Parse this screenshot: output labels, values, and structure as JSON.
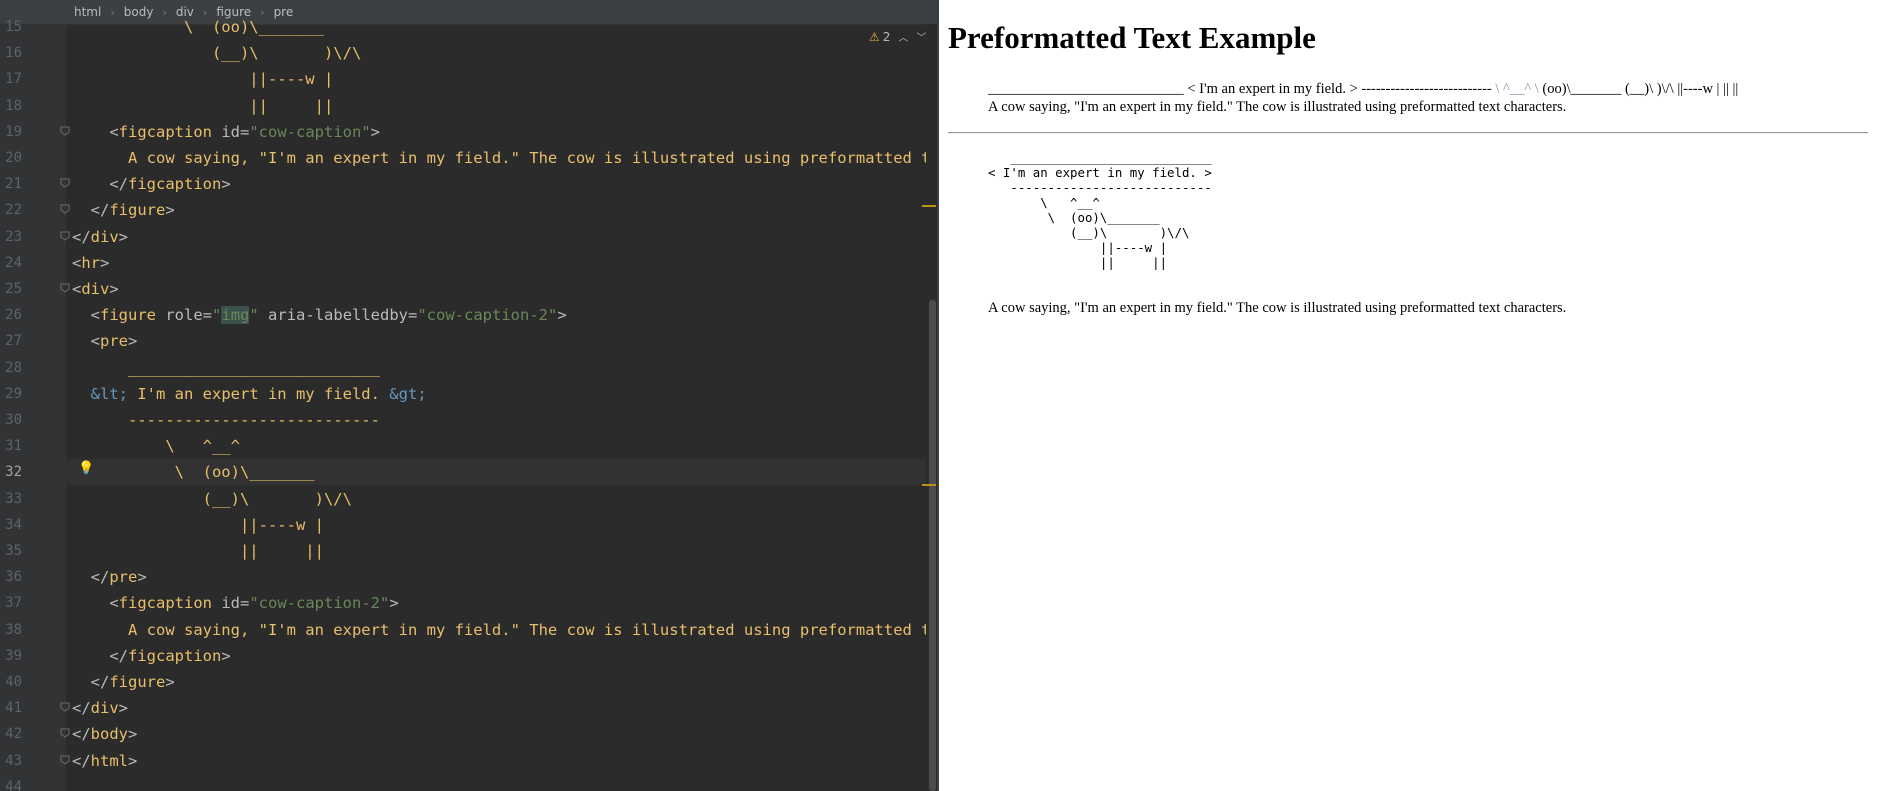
{
  "breadcrumb": [
    "html",
    "body",
    "div",
    "figure",
    "pre"
  ],
  "warnings": {
    "count": "2"
  },
  "colors": {
    "tag": "#e8bf6a",
    "attr_value": "#6a8759",
    "entity": "#6897bb",
    "text": "#a9b7c6",
    "warning": "#e6b34b"
  },
  "code_lines": [
    {
      "n": "15",
      "tokens": [
        [
          "t",
          "            \\  (oo)\\_______"
        ]
      ]
    },
    {
      "n": "16",
      "tokens": [
        [
          "t",
          "               (__)\\       )\\/\\"
        ]
      ]
    },
    {
      "n": "17",
      "tokens": [
        [
          "t",
          "                   ||----w |"
        ]
      ]
    },
    {
      "n": "18",
      "tokens": [
        [
          "t",
          "                   ||     ||"
        ]
      ]
    },
    {
      "n": "19",
      "tokens": [
        [
          "t",
          "    "
        ],
        [
          "p",
          "<"
        ],
        [
          "b",
          "figcaption"
        ],
        [
          "a",
          " id="
        ],
        [
          "s",
          "\"cow-caption\""
        ],
        [
          "p",
          ">"
        ]
      ]
    },
    {
      "n": "20",
      "tokens": [
        [
          "t",
          "      A cow saying, \"I'm an expert in my field.\" The cow is illustrated using preformatted text c"
        ]
      ]
    },
    {
      "n": "21",
      "tokens": [
        [
          "t",
          "    "
        ],
        [
          "p",
          "</"
        ],
        [
          "b",
          "figcaption"
        ],
        [
          "p",
          ">"
        ]
      ]
    },
    {
      "n": "22",
      "tokens": [
        [
          "t",
          "  "
        ],
        [
          "p",
          "</"
        ],
        [
          "b",
          "figure"
        ],
        [
          "p",
          ">"
        ]
      ]
    },
    {
      "n": "23",
      "tokens": [
        [
          "p",
          "</"
        ],
        [
          "b",
          "div"
        ],
        [
          "p",
          ">"
        ]
      ]
    },
    {
      "n": "24",
      "tokens": [
        [
          "p",
          "<"
        ],
        [
          "b",
          "hr"
        ],
        [
          "p",
          ">"
        ]
      ]
    },
    {
      "n": "25",
      "tokens": [
        [
          "p",
          "<"
        ],
        [
          "b",
          "div"
        ],
        [
          "p",
          ">"
        ]
      ]
    },
    {
      "n": "26",
      "tokens": [
        [
          "t",
          "  "
        ],
        [
          "p",
          "<"
        ],
        [
          "b",
          "figure"
        ],
        [
          "a",
          " role="
        ],
        [
          "s",
          "\""
        ],
        [
          "hl",
          "img"
        ],
        [
          "s",
          "\""
        ],
        [
          "a",
          " aria-labelledby="
        ],
        [
          "s",
          "\"cow-caption-2\""
        ],
        [
          "p",
          ">"
        ]
      ]
    },
    {
      "n": "27",
      "tokens": [
        [
          "t",
          "  "
        ],
        [
          "p",
          "<"
        ],
        [
          "b",
          "pre"
        ],
        [
          "p",
          ">"
        ]
      ]
    },
    {
      "n": "28",
      "tokens": [
        [
          "t",
          "      ___________________________"
        ]
      ]
    },
    {
      "n": "29",
      "tokens": [
        [
          "t",
          "  "
        ],
        [
          "e",
          "&lt;"
        ],
        [
          "t",
          " I'm an expert in my field. "
        ],
        [
          "e",
          "&gt;"
        ]
      ]
    },
    {
      "n": "30",
      "tokens": [
        [
          "t",
          "      ---------------------------"
        ]
      ]
    },
    {
      "n": "31",
      "tokens": [
        [
          "t",
          "          \\   ^__^"
        ]
      ]
    },
    {
      "n": "32",
      "tokens": [
        [
          "t",
          "           \\  (oo)\\_______"
        ]
      ]
    },
    {
      "n": "33",
      "tokens": [
        [
          "t",
          "              (__)\\       )\\/\\"
        ]
      ]
    },
    {
      "n": "34",
      "tokens": [
        [
          "t",
          "                  ||----w |"
        ]
      ]
    },
    {
      "n": "35",
      "tokens": [
        [
          "t",
          "                  ||     ||"
        ]
      ]
    },
    {
      "n": "36",
      "tokens": [
        [
          "t",
          "  "
        ],
        [
          "p",
          "</"
        ],
        [
          "b",
          "pre"
        ],
        [
          "p",
          ">"
        ]
      ]
    },
    {
      "n": "37",
      "tokens": [
        [
          "t",
          "    "
        ],
        [
          "p",
          "<"
        ],
        [
          "b",
          "figcaption"
        ],
        [
          "a",
          " id="
        ],
        [
          "s",
          "\"cow-caption-2\""
        ],
        [
          "p",
          ">"
        ]
      ]
    },
    {
      "n": "38",
      "tokens": [
        [
          "t",
          "      A cow saying, \"I'm an expert in my field.\" The cow is illustrated using preformatted text c"
        ]
      ]
    },
    {
      "n": "39",
      "tokens": [
        [
          "t",
          "    "
        ],
        [
          "p",
          "</"
        ],
        [
          "b",
          "figcaption"
        ],
        [
          "p",
          ">"
        ]
      ]
    },
    {
      "n": "40",
      "tokens": [
        [
          "t",
          "  "
        ],
        [
          "p",
          "</"
        ],
        [
          "b",
          "figure"
        ],
        [
          "p",
          ">"
        ]
      ]
    },
    {
      "n": "41",
      "tokens": [
        [
          "p",
          "</"
        ],
        [
          "b",
          "div"
        ],
        [
          "p",
          ">"
        ]
      ]
    },
    {
      "n": "42",
      "tokens": [
        [
          "p",
          "</"
        ],
        [
          "b",
          "body"
        ],
        [
          "p",
          ">"
        ]
      ]
    },
    {
      "n": "43",
      "tokens": [
        [
          "p",
          "</"
        ],
        [
          "b",
          "html"
        ],
        [
          "p",
          ">"
        ]
      ]
    },
    {
      "n": "44",
      "tokens": []
    }
  ],
  "preview": {
    "title": "Preformatted Text Example",
    "figure1_text": "___________________________ < I'm an expert in my field. > --------------------------- ",
    "figure1_faint": "\\ ^__^ \\",
    "figure1_text_b": " (oo)\\_______ (__)\\ )\\/\\ ||----w | || ||",
    "caption1": "A cow saying, \"I'm an expert in my field.\" The cow is illustrated using preformatted text characters.",
    "ascii": "   ___________________________\n< I'm an expert in my field. >\n   ---------------------------\n       \\   ^__^\n        \\  (oo)\\_______\n           (__)\\       )\\/\\\n               ||----w |\n               ||     ||",
    "caption2": "A cow saying, \"I'm an expert in my field.\" The cow is illustrated using preformatted text characters."
  }
}
